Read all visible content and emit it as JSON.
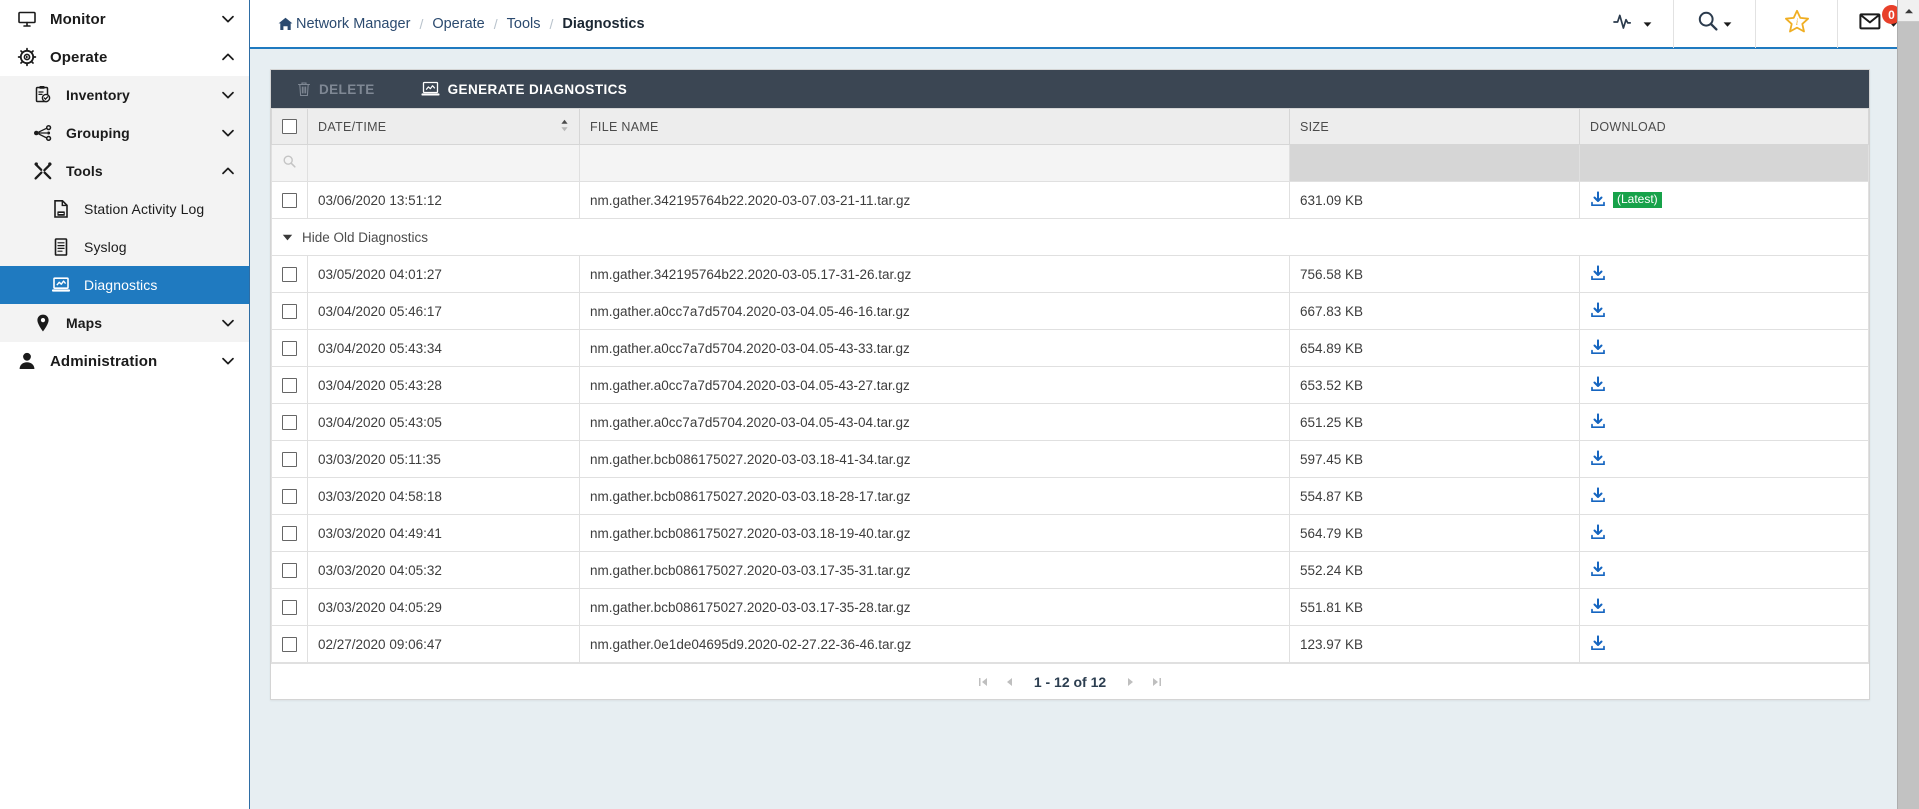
{
  "sidebar": {
    "items": [
      {
        "label": "Monitor",
        "icon": "monitor-icon",
        "level": 0,
        "chevron": "down",
        "active": false
      },
      {
        "label": "Operate",
        "icon": "gear-play-icon",
        "level": 0,
        "chevron": "up",
        "active": false
      },
      {
        "label": "Inventory",
        "icon": "clipboard-check-icon",
        "level": 1,
        "chevron": "down",
        "active": false
      },
      {
        "label": "Grouping",
        "icon": "grouping-icon",
        "level": 1,
        "chevron": "down",
        "active": false
      },
      {
        "label": "Tools",
        "icon": "tools-icon",
        "level": 1,
        "chevron": "up",
        "active": false
      },
      {
        "label": "Station Activity Log",
        "icon": "log-document-icon",
        "level": 2,
        "chevron": "none",
        "active": false
      },
      {
        "label": "Syslog",
        "icon": "document-lines-icon",
        "level": 2,
        "chevron": "none",
        "active": false
      },
      {
        "label": "Diagnostics",
        "icon": "laptop-chart-icon",
        "level": 2,
        "chevron": "none",
        "active": true
      },
      {
        "label": "Maps",
        "icon": "map-pin-icon",
        "level": 1,
        "chevron": "down",
        "active": false
      },
      {
        "label": "Administration",
        "icon": "user-icon",
        "level": 0,
        "chevron": "down",
        "active": false
      }
    ]
  },
  "topbar": {
    "breadcrumb": [
      {
        "label": "Network Manager",
        "home": true,
        "last": false
      },
      {
        "label": "Operate",
        "home": false,
        "last": false
      },
      {
        "label": "Tools",
        "home": false,
        "last": false
      },
      {
        "label": "Diagnostics",
        "home": false,
        "last": true
      }
    ],
    "separator": "/",
    "icons": [
      {
        "name": "pulse-icon",
        "caret": true,
        "badge": null
      },
      {
        "name": "search-icon",
        "caret": true,
        "badge": null
      },
      {
        "name": "star-info-icon",
        "caret": false,
        "badge": null
      },
      {
        "name": "mail-icon",
        "caret": true,
        "badge": "0"
      }
    ]
  },
  "toolbar": {
    "delete_label": "DELETE",
    "generate_label": "GENERATE DIAGNOSTICS"
  },
  "table": {
    "columns": [
      "DATE/TIME",
      "FILE NAME",
      "SIZE",
      "DOWNLOAD"
    ],
    "sorted_column": "DATE/TIME",
    "filter_placeholder": "",
    "group_row": {
      "label": "Hide Old Diagnostics",
      "expanded": true
    },
    "latest_badge": "(Latest)",
    "rows": [
      {
        "datetime": "03/06/2020 13:51:12",
        "filename": "nm.gather.342195764b22.2020-03-07.03-21-11.tar.gz",
        "size": "631.09 KB",
        "latest": true
      },
      {
        "datetime": "03/05/2020 04:01:27",
        "filename": "nm.gather.342195764b22.2020-03-05.17-31-26.tar.gz",
        "size": "756.58 KB",
        "latest": false
      },
      {
        "datetime": "03/04/2020 05:46:17",
        "filename": "nm.gather.a0cc7a7d5704.2020-03-04.05-46-16.tar.gz",
        "size": "667.83 KB",
        "latest": false
      },
      {
        "datetime": "03/04/2020 05:43:34",
        "filename": "nm.gather.a0cc7a7d5704.2020-03-04.05-43-33.tar.gz",
        "size": "654.89 KB",
        "latest": false
      },
      {
        "datetime": "03/04/2020 05:43:28",
        "filename": "nm.gather.a0cc7a7d5704.2020-03-04.05-43-27.tar.gz",
        "size": "653.52 KB",
        "latest": false
      },
      {
        "datetime": "03/04/2020 05:43:05",
        "filename": "nm.gather.a0cc7a7d5704.2020-03-04.05-43-04.tar.gz",
        "size": "651.25 KB",
        "latest": false
      },
      {
        "datetime": "03/03/2020 05:11:35",
        "filename": "nm.gather.bcb086175027.2020-03-03.18-41-34.tar.gz",
        "size": "597.45 KB",
        "latest": false
      },
      {
        "datetime": "03/03/2020 04:58:18",
        "filename": "nm.gather.bcb086175027.2020-03-03.18-28-17.tar.gz",
        "size": "554.87 KB",
        "latest": false
      },
      {
        "datetime": "03/03/2020 04:49:41",
        "filename": "nm.gather.bcb086175027.2020-03-03.18-19-40.tar.gz",
        "size": "564.79 KB",
        "latest": false
      },
      {
        "datetime": "03/03/2020 04:05:32",
        "filename": "nm.gather.bcb086175027.2020-03-03.17-35-31.tar.gz",
        "size": "552.24 KB",
        "latest": false
      },
      {
        "datetime": "03/03/2020 04:05:29",
        "filename": "nm.gather.bcb086175027.2020-03-03.17-35-28.tar.gz",
        "size": "551.81 KB",
        "latest": false
      },
      {
        "datetime": "02/27/2020 09:06:47",
        "filename": "nm.gather.0e1de04695d9.2020-02-27.22-36-46.tar.gz",
        "size": "123.97 KB",
        "latest": false
      }
    ]
  },
  "pagination": {
    "label": "1 - 12 of 12",
    "first": "first-page-icon",
    "prev": "prev-page-icon",
    "next": "next-page-icon",
    "last": "last-page-icon"
  },
  "colors": {
    "accent": "#1f7ac0",
    "toolbar_bg": "#3b4653",
    "latest_badge": "#17a24a",
    "badge_red": "#e8402a",
    "download_blue": "#1565c0"
  }
}
